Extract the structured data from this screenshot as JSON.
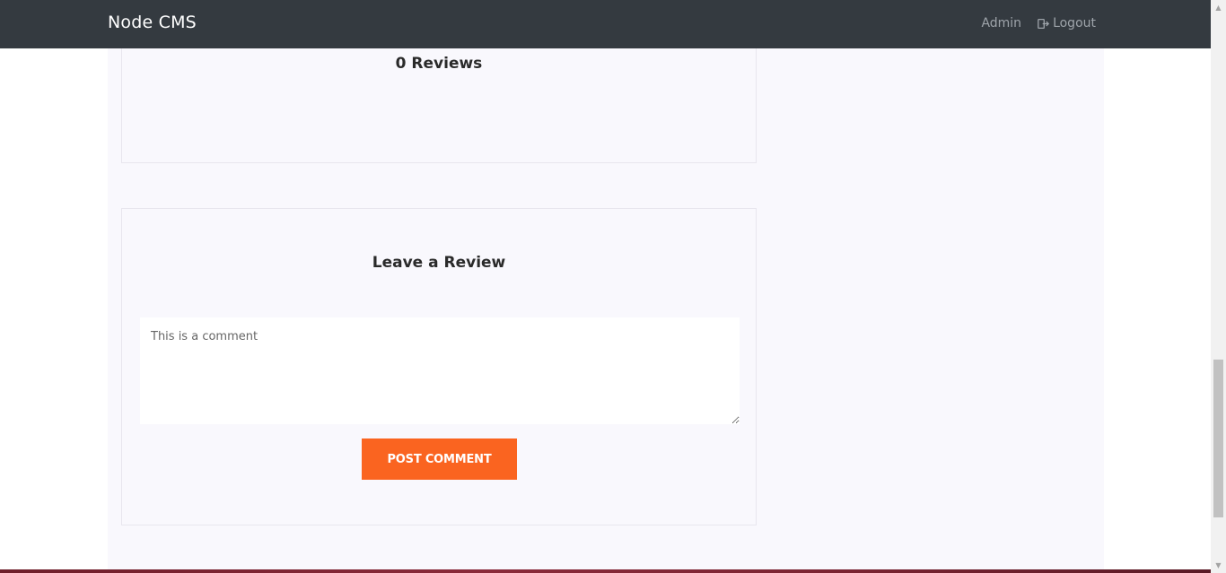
{
  "navbar": {
    "brand": "Node CMS",
    "links": [
      {
        "label": "Admin",
        "icon": ""
      },
      {
        "label": "Logout",
        "icon": "logout-icon"
      }
    ]
  },
  "reviews": {
    "title": "0 Reviews"
  },
  "review_form": {
    "title": "Leave a Review",
    "comment_placeholder": "This is a comment",
    "submit_label": "POST COMMENT"
  },
  "colors": {
    "navbar_bg": "#343a40",
    "accent": "#fa6420",
    "content_bg": "#f9f8fd"
  }
}
